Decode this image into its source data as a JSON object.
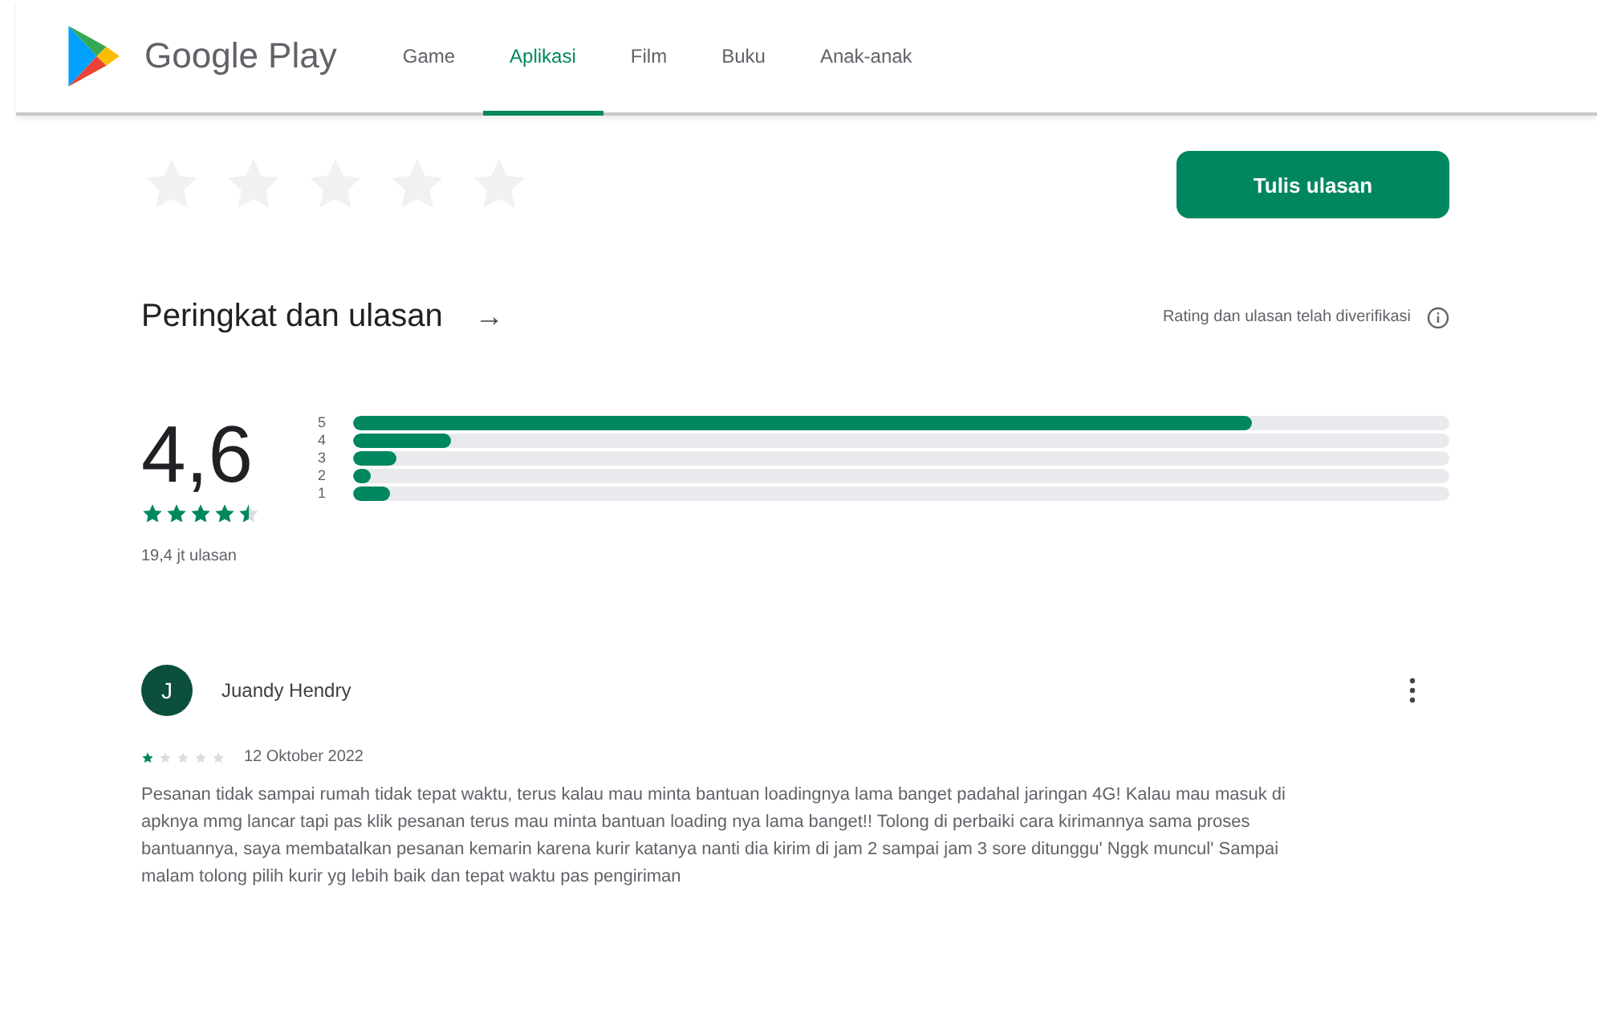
{
  "header": {
    "brand": "Google Play",
    "tabs": [
      {
        "label": "Game",
        "selected": false
      },
      {
        "label": "Aplikasi",
        "selected": true
      },
      {
        "label": "Film",
        "selected": false
      },
      {
        "label": "Buku",
        "selected": false
      },
      {
        "label": "Anak-anak",
        "selected": false
      }
    ]
  },
  "rate": {
    "button": "Tulis ulasan"
  },
  "ratings": {
    "title": "Peringkat dan ulasan",
    "arrow": "→",
    "verified": "Rating dan ulasan telah diverifikasi",
    "score": "4,6",
    "stars": 4.5,
    "count": "19,4 jt ulasan",
    "bars": [
      {
        "label": "5",
        "level": 0.82
      },
      {
        "label": "4",
        "level": 0.09
      },
      {
        "label": "3",
        "level": 0.04
      },
      {
        "label": "2",
        "level": 0.016
      },
      {
        "label": "1",
        "level": 0.034
      }
    ]
  },
  "review": {
    "initial": "J",
    "author": "Juandy Hendry",
    "stars": 1,
    "date": "12 Oktober 2022",
    "text": "Pesanan tidak sampai rumah tidak tepat waktu, terus kalau mau minta bantuan loadingnya lama banget padahal jaringan 4G! Kalau mau masuk di apknya mmg lancar tapi pas klik pesanan terus mau minta bantuan loading nya lama banget!! Tolong di perbaiki cara kirimannya sama proses bantuannya, saya membatalkan pesanan kemarin karena kurir katanya nanti dia kirim di jam 2 sampai jam 3 sore ditunggu' Nggk muncul' Sampai malam tolong pilih kurir yg lebih baik dan tepat waktu pas pengiriman"
  }
}
